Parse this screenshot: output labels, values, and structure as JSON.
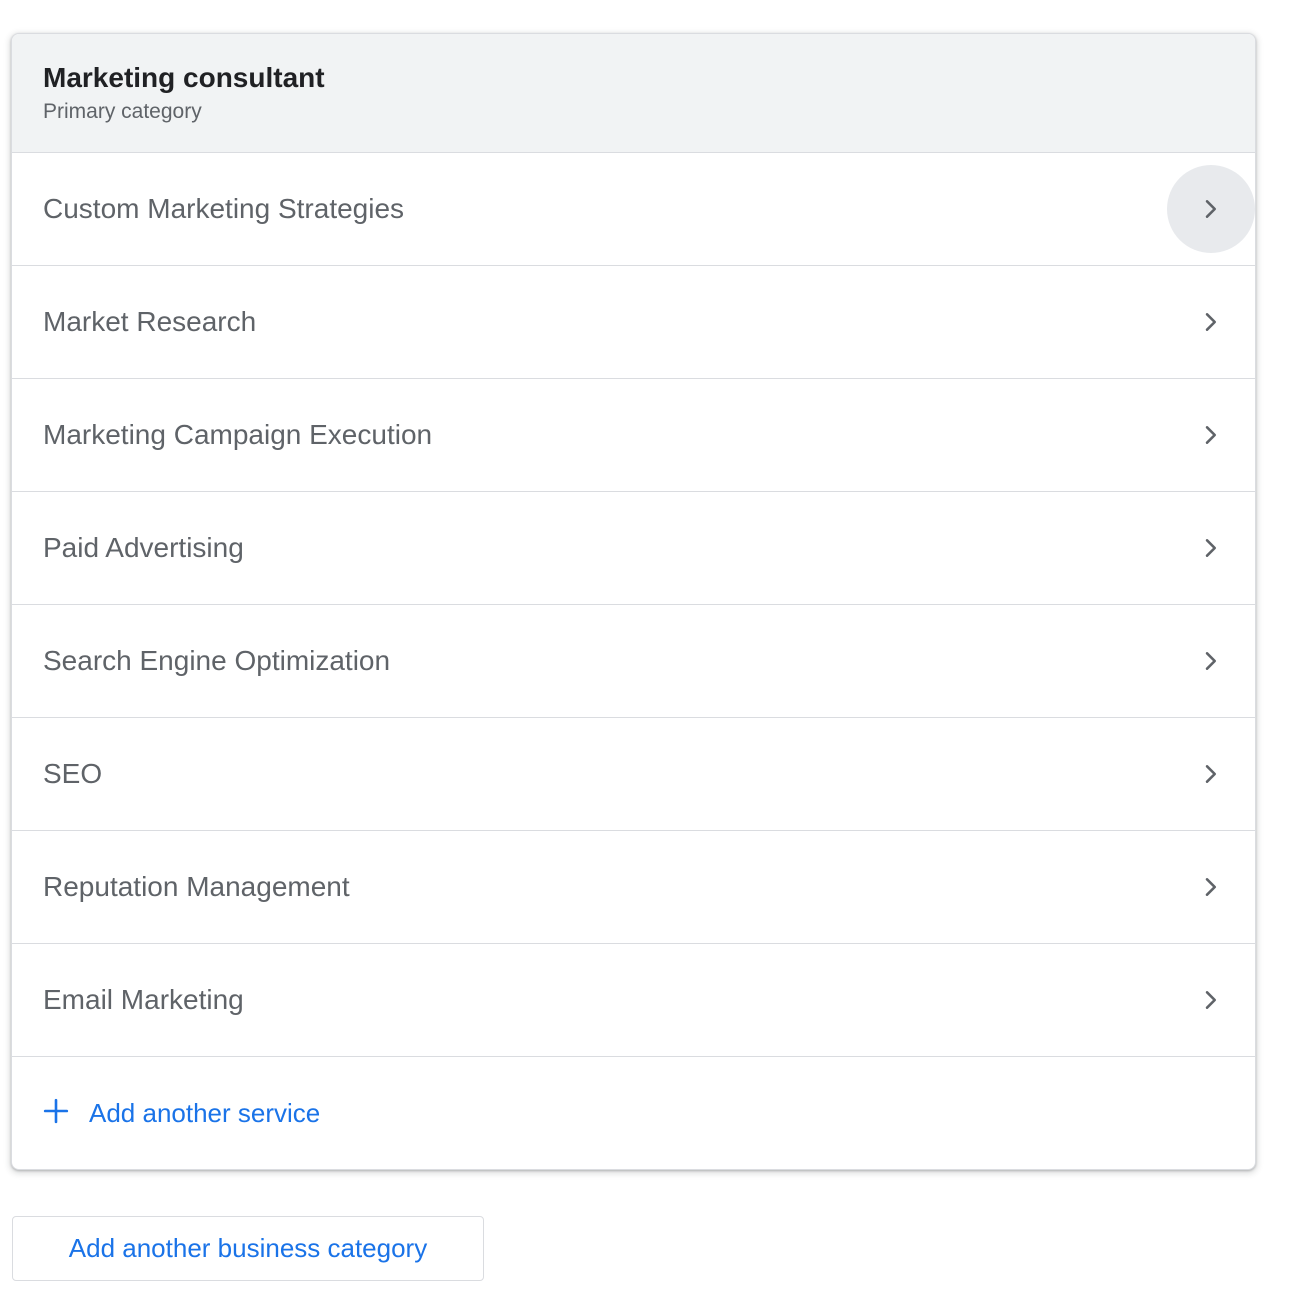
{
  "category": {
    "title": "Marketing consultant",
    "subtitle": "Primary category"
  },
  "services": [
    {
      "label": "Custom Marketing Strategies",
      "icon": "chevron-right-icon",
      "hovered": true
    },
    {
      "label": "Market Research",
      "icon": "chevron-right-icon"
    },
    {
      "label": "Marketing Campaign Execution",
      "icon": "chevron-right-icon"
    },
    {
      "label": "Paid Advertising",
      "icon": "chevron-right-icon"
    },
    {
      "label": "Search Engine Optimization",
      "icon": "chevron-right-icon"
    },
    {
      "label": "SEO",
      "icon": "chevron-right-icon"
    },
    {
      "label": "Reputation Management",
      "icon": "chevron-right-icon"
    },
    {
      "label": "Email Marketing",
      "icon": "chevron-right-icon"
    }
  ],
  "add_service": {
    "icon": "plus-icon",
    "label": "Add another service"
  },
  "add_category_button": {
    "label": "Add another business category"
  },
  "colors": {
    "accent": "#1a73e8",
    "header_bg": "#f1f3f4",
    "text_primary": "#202124",
    "text_secondary": "#5f6368",
    "divider": "#dadce0",
    "hover_bg": "#e8eaed"
  }
}
